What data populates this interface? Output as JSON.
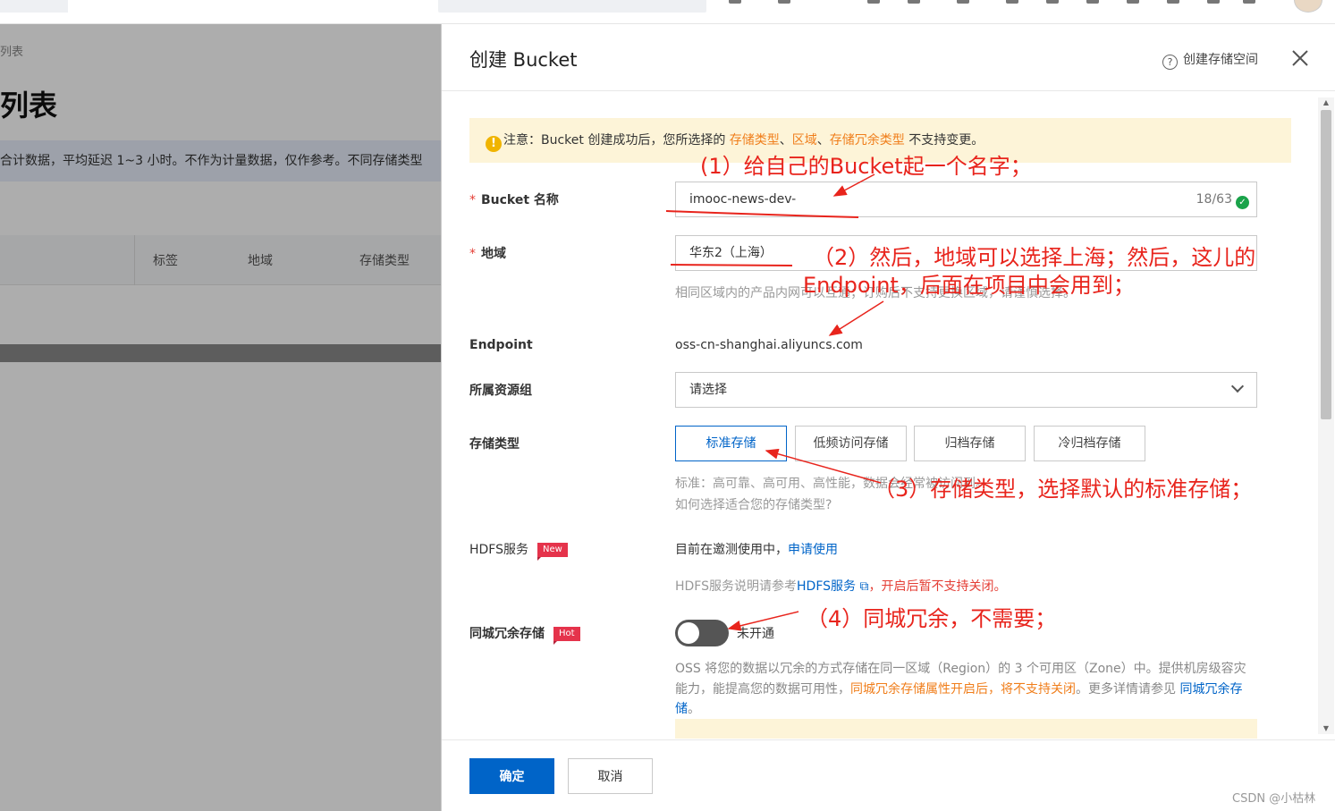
{
  "background": {
    "breadcrumb": "列表",
    "title": "列表",
    "notice": "合计数据，平均延迟 1~3 小时。不作为计量数据，仅作参考。不同存储类型",
    "table_headers": [
      "标签",
      "地域",
      "存储类型"
    ]
  },
  "drawer": {
    "title": "创建 Bucket",
    "help_link": "创建存储空间",
    "warning": {
      "prefix": "注意：Bucket 创建成功后，您所选择的 ",
      "link1": "存储类型",
      "sep1": "、",
      "link2": "区域",
      "sep2": "、",
      "link3": "存储冗余类型",
      "suffix": " 不支持变更。"
    },
    "bucket_name": {
      "label": "Bucket 名称",
      "value": "imooc-news-dev-",
      "count": "18/63"
    },
    "region": {
      "label": "地域",
      "value": "华东2（上海）",
      "hint": "相同区域内的产品内网可以互通；订购后不支持更换区域，请谨慎选择。"
    },
    "endpoint": {
      "label": "Endpoint",
      "value": "oss-cn-shanghai.aliyuncs.com"
    },
    "resource_group": {
      "label": "所属资源组",
      "placeholder": "请选择"
    },
    "storage_type": {
      "label": "存储类型",
      "options": [
        "标准存储",
        "低频访问存储",
        "归档存储",
        "冷归档存储"
      ],
      "selected": "标准存储",
      "hint": "标准：高可靠、高可用、高性能，数据会经常被访问到。",
      "help_link": "如何选择适合您的存储类型?"
    },
    "hdfs": {
      "label": "HDFS服务",
      "badge": "New",
      "status": "目前在邀测使用中，",
      "apply_link": "申请使用",
      "desc_prefix": "HDFS服务说明请参考",
      "desc_link": "HDFS服务",
      "desc_warn": "，开启后暂不支持关闭。"
    },
    "zrs": {
      "label": "同城冗余存储",
      "badge": "Hot",
      "toggle_state": "off",
      "toggle_label": "未开通",
      "desc_1": "OSS 将您的数据以冗余的方式存储在同一区域（Region）的 3 个可用区（Zone）中。提供机房级容灾能力，能提高您的数据可用性，",
      "desc_warn": "同城冗余存储属性开启后，将不支持关闭",
      "desc_2": "。更多详情请参见 ",
      "desc_link": "同城冗余存储",
      "desc_end": "。"
    },
    "footer": {
      "confirm": "确定",
      "cancel": "取消"
    }
  },
  "annotations": [
    "(1）给自己的Bucket起一个名字；",
    "（2）然后，地域可以选择上海；然后，这儿的",
    "Endpoint，后面在项目中会用到；",
    "（3）存储类型，选择默认的标准存储；",
    "（4）同城冗余，不需要；"
  ],
  "watermark": "CSDN @小枯林",
  "colors": {
    "primary": "#0064c8",
    "warning_bg": "#fdf4d8",
    "orange_link": "#f07e1b",
    "annotation_red": "#e8241c"
  }
}
